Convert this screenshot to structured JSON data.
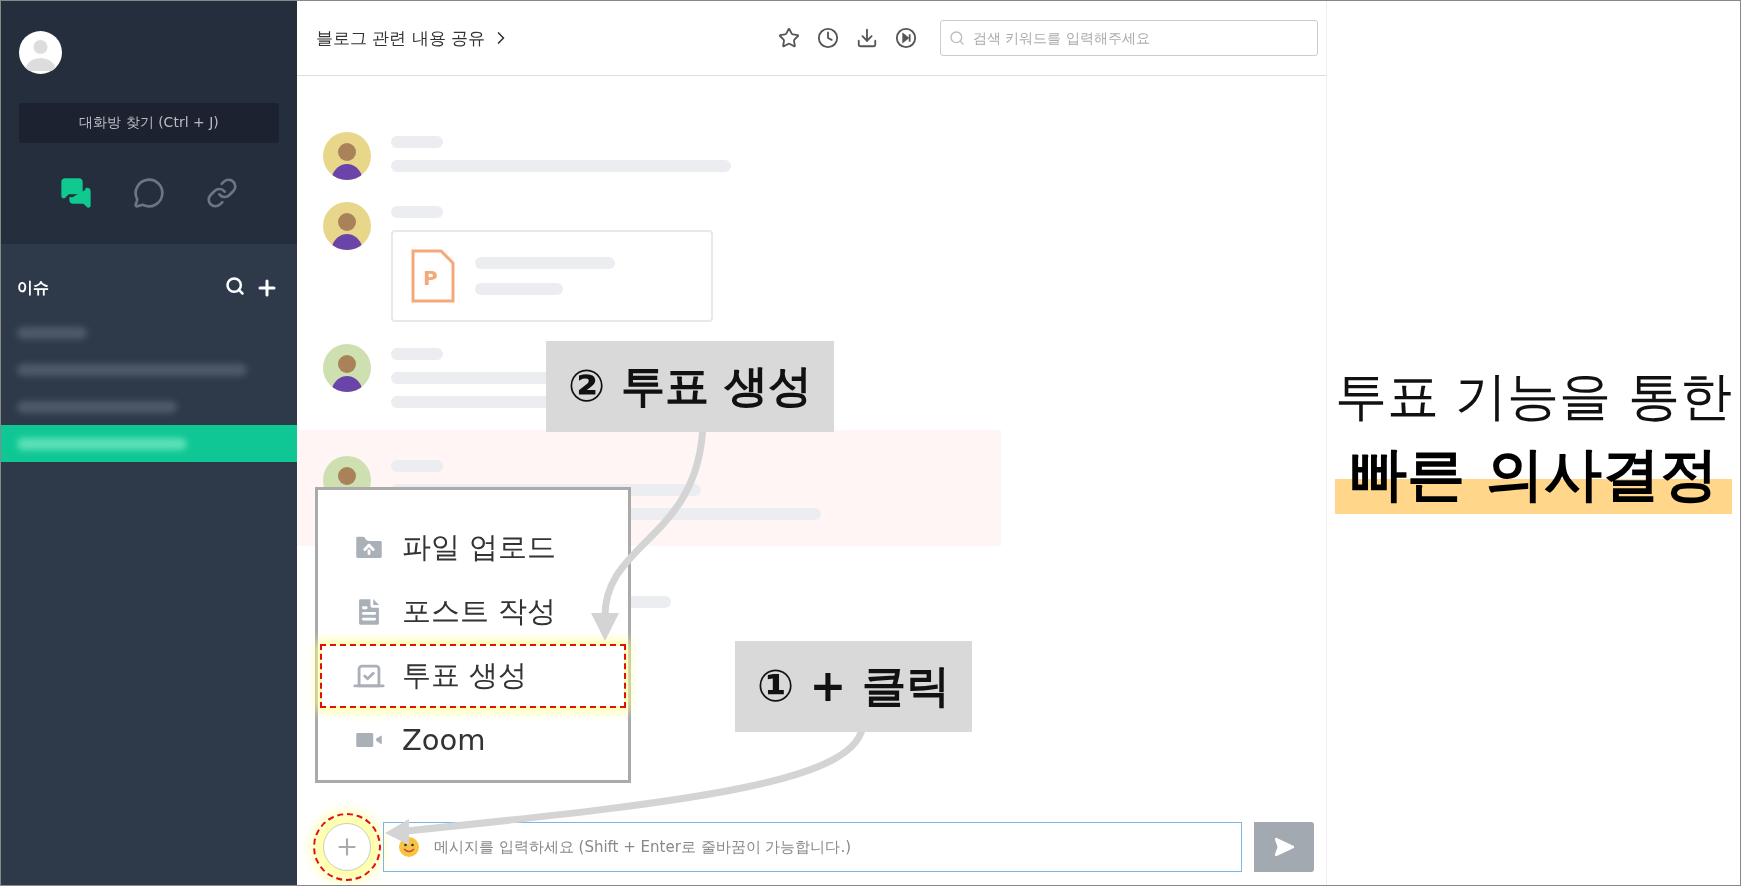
{
  "sidebar": {
    "search_button": "대화방 찾기 (Ctrl + J)",
    "tabs": [
      {
        "kind": "chats",
        "selected": true
      },
      {
        "kind": "chat",
        "selected": false
      },
      {
        "kind": "link",
        "selected": false
      }
    ],
    "section_title": "이슈",
    "items": [
      {
        "selected": false
      },
      {
        "selected": false
      },
      {
        "selected": false
      },
      {
        "selected": true
      }
    ]
  },
  "header": {
    "title": "블로그 관련 내용 공유",
    "search": {
      "placeholder": "검색 키워드를 입력해주세요"
    }
  },
  "messages": [
    {
      "kind": "text",
      "highlighted": false
    },
    {
      "kind": "file",
      "highlighted": false,
      "file_letter": "P"
    },
    {
      "kind": "text",
      "highlighted": false
    },
    {
      "kind": "text",
      "highlighted": true
    },
    {
      "kind": "text",
      "highlighted": false
    }
  ],
  "attach_menu": {
    "items": [
      {
        "label": "파일 업로드",
        "kind": "upload",
        "selected": false
      },
      {
        "label": "포스트 작성",
        "kind": "post",
        "selected": false
      },
      {
        "label": "투표 생성",
        "kind": "vote",
        "selected": true
      },
      {
        "label": "Zoom",
        "kind": "zoom",
        "selected": false
      }
    ]
  },
  "composer": {
    "placeholder": "메시지를 입력하세요 (Shift + Enter로 줄바꿈이 가능합니다.)"
  },
  "callouts": [
    {
      "label": "② 투표 생성"
    },
    {
      "label": "① + 클릭"
    }
  ],
  "headline": {
    "line_1": "투표 기능을 통한",
    "line_2": "빠른 의사결정"
  }
}
